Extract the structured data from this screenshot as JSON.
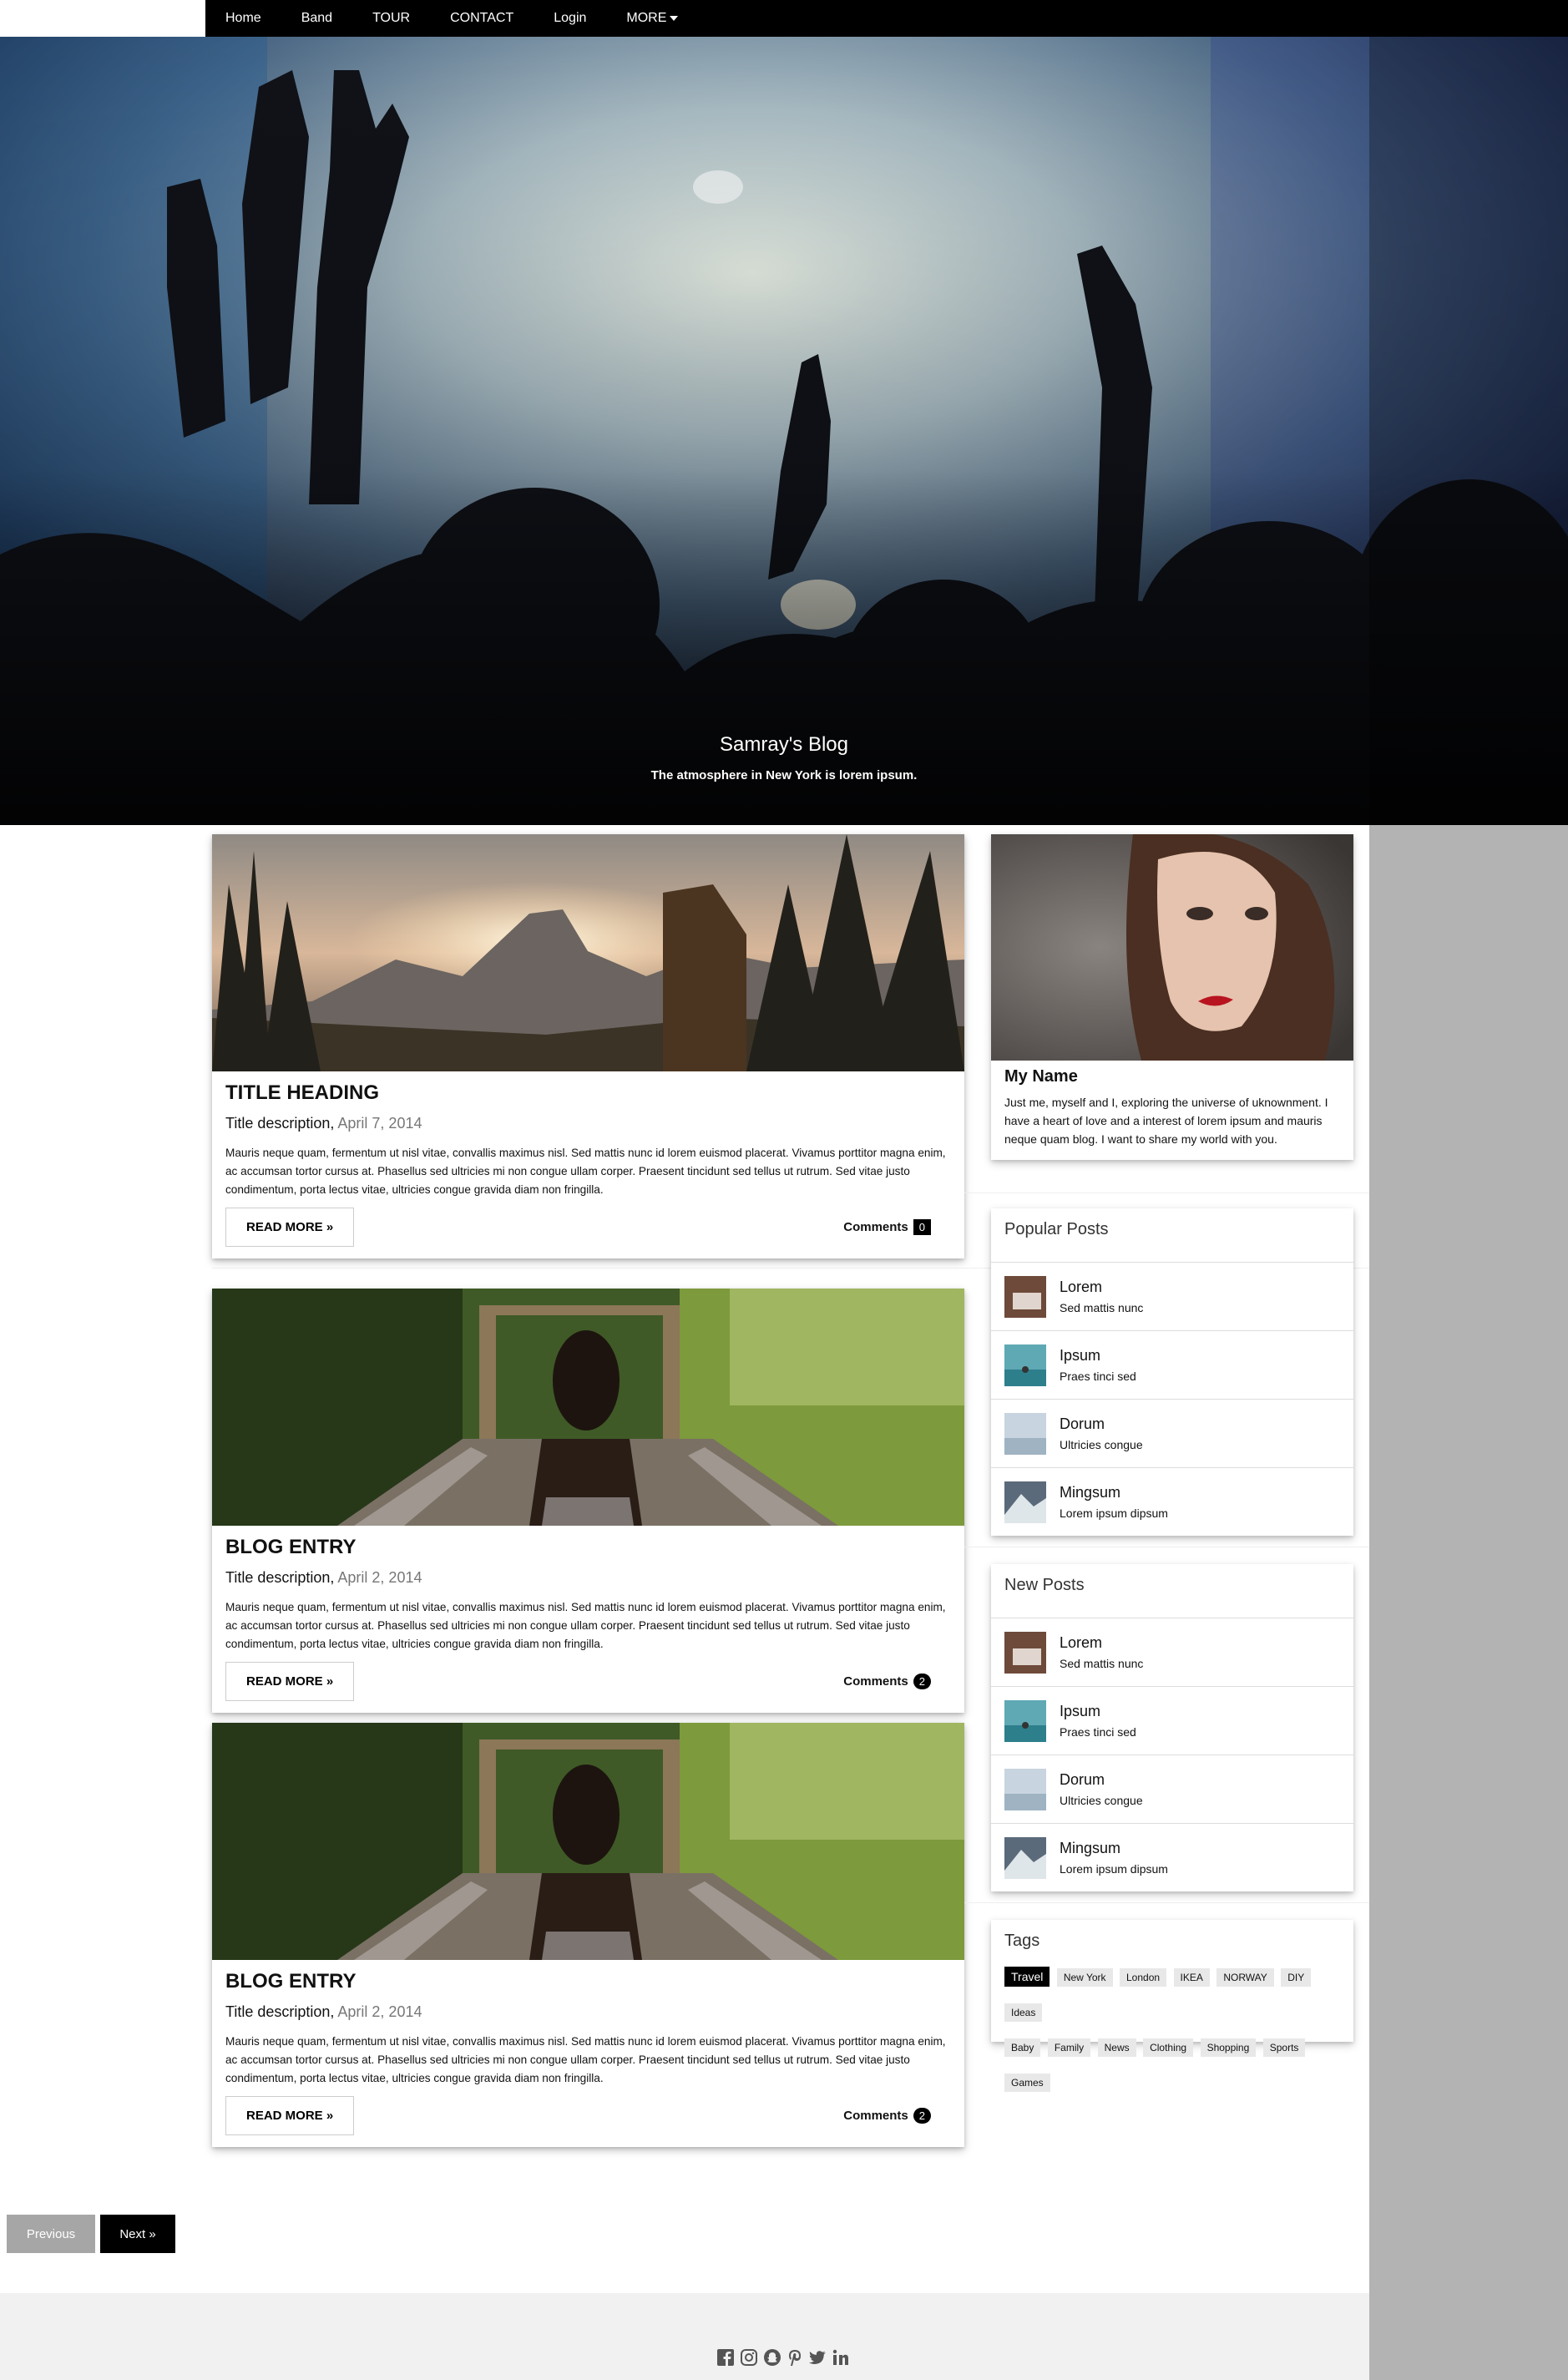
{
  "nav": {
    "items": [
      "Home",
      "Band",
      "TOUR",
      "CONTACT",
      "Login"
    ],
    "more_label": "MORE"
  },
  "hero": {
    "title": "Samray's Blog",
    "subtitle": "The atmosphere in New York is lorem ipsum."
  },
  "posts": [
    {
      "title": "TITLE HEADING",
      "desc": "Title description,",
      "date": "April 7, 2014",
      "body": "Mauris neque quam, fermentum ut nisl vitae, convallis maximus nisl. Sed mattis nunc id lorem euismod placerat. Vivamus porttitor magna enim, ac accumsan tortor cursus at. Phasellus sed ultricies mi non congue ullam corper. Praesent tincidunt sed tellus ut rutrum. Sed vitae justo condimentum, porta lectus vitae, ultricies congue gravida diam non fringilla.",
      "read_more": "READ MORE »",
      "comments_label": "Comments",
      "comments_count": "0"
    },
    {
      "title": "BLOG ENTRY",
      "desc": "Title description,",
      "date": "April 2, 2014",
      "body": "Mauris neque quam, fermentum ut nisl vitae, convallis maximus nisl. Sed mattis nunc id lorem euismod placerat. Vivamus porttitor magna enim, ac accumsan tortor cursus at. Phasellus sed ultricies mi non congue ullam corper. Praesent tincidunt sed tellus ut rutrum. Sed vitae justo condimentum, porta lectus vitae, ultricies congue gravida diam non fringilla.",
      "read_more": "READ MORE »",
      "comments_label": "Comments",
      "comments_count": "2"
    },
    {
      "title": "BLOG ENTRY",
      "desc": "Title description,",
      "date": "April 2, 2014",
      "body": "Mauris neque quam, fermentum ut nisl vitae, convallis maximus nisl. Sed mattis nunc id lorem euismod placerat. Vivamus porttitor magna enim, ac accumsan tortor cursus at. Phasellus sed ultricies mi non congue ullam corper. Praesent tincidunt sed tellus ut rutrum. Sed vitae justo condimentum, porta lectus vitae, ultricies congue gravida diam non fringilla.",
      "read_more": "READ MORE »",
      "comments_label": "Comments",
      "comments_count": "2"
    }
  ],
  "profile": {
    "name": "My Name",
    "about": "Just me, myself and I, exploring the universe of uknownment. I have a heart of love and a interest of lorem ipsum and mauris neque quam blog. I want to share my world with you."
  },
  "popular": {
    "heading": "Popular Posts",
    "items": [
      {
        "title": "Lorem",
        "sub": "Sed mattis nunc"
      },
      {
        "title": "Ipsum",
        "sub": "Praes tinci sed"
      },
      {
        "title": "Dorum",
        "sub": "Ultricies congue"
      },
      {
        "title": "Mingsum",
        "sub": "Lorem ipsum dipsum"
      }
    ]
  },
  "new_posts": {
    "heading": "New Posts",
    "items": [
      {
        "title": "Lorem",
        "sub": "Sed mattis nunc"
      },
      {
        "title": "Ipsum",
        "sub": "Praes tinci sed"
      },
      {
        "title": "Dorum",
        "sub": "Ultricies congue"
      },
      {
        "title": "Mingsum",
        "sub": "Lorem ipsum dipsum"
      }
    ]
  },
  "tags": {
    "heading": "Tags",
    "row1": [
      "Travel",
      "New York",
      "London",
      "IKEA",
      "NORWAY",
      "DIY",
      "Ideas"
    ],
    "row2": [
      "Baby",
      "Family",
      "News",
      "Clothing",
      "Shopping",
      "Sports",
      "Games"
    ]
  },
  "pagination": {
    "prev": "Previous",
    "next": "Next »"
  },
  "footer": {
    "icons": [
      "facebook-icon",
      "instagram-icon",
      "snapchat-icon",
      "pinterest-icon",
      "twitter-icon",
      "linkedin-icon"
    ]
  }
}
